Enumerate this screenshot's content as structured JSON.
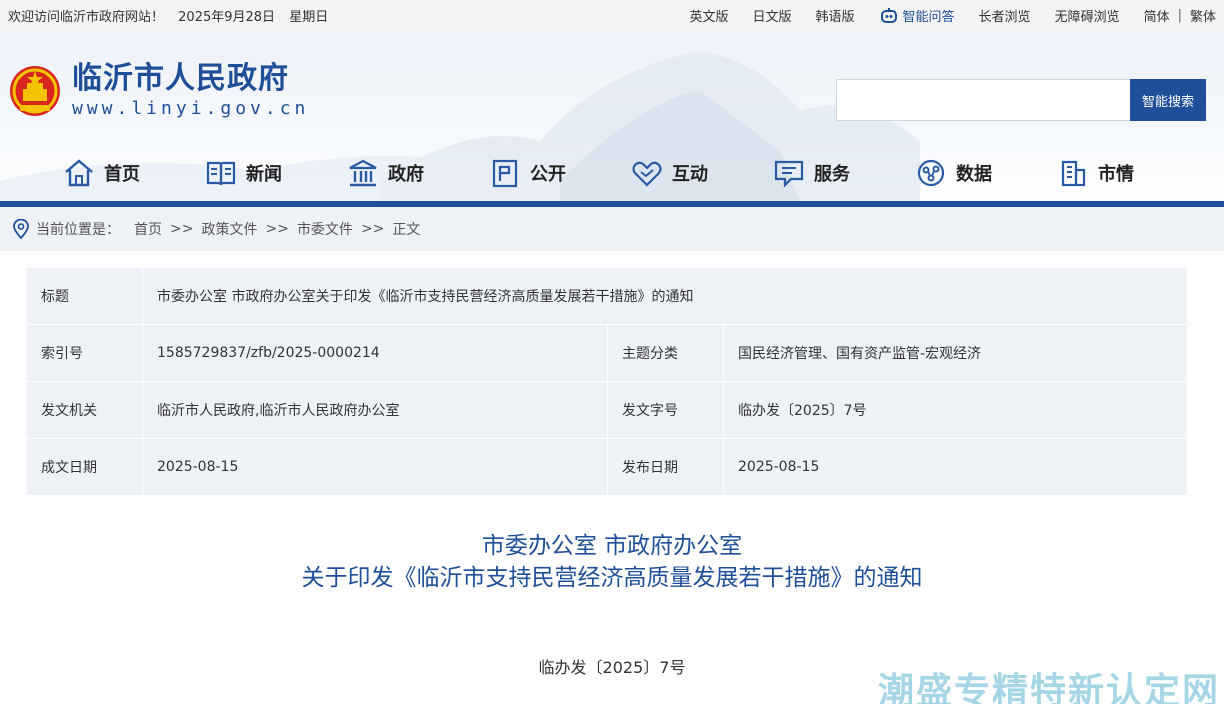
{
  "topbar": {
    "welcome": "欢迎访问临沂市政府网站！",
    "date": "2025年9月28日",
    "weekday": "星期日",
    "links": [
      "英文版",
      "日文版",
      "韩语版"
    ],
    "qa_label": "智能问答",
    "elder": "长者浏览",
    "accessible": "无障碍浏览",
    "simplified": "简体",
    "separator": "|",
    "traditional": "繁体"
  },
  "brand": {
    "title": "临沂市人民政府",
    "url": "www.linyi.gov.cn"
  },
  "search": {
    "placeholder": "",
    "button": "智能搜索"
  },
  "nav": [
    {
      "label": "首页",
      "icon": "home-icon"
    },
    {
      "label": "新闻",
      "icon": "news-icon"
    },
    {
      "label": "政府",
      "icon": "government-icon"
    },
    {
      "label": "公开",
      "icon": "disclosure-icon"
    },
    {
      "label": "互动",
      "icon": "interaction-icon"
    },
    {
      "label": "服务",
      "icon": "service-icon"
    },
    {
      "label": "数据",
      "icon": "data-icon"
    },
    {
      "label": "市情",
      "icon": "city-icon"
    }
  ],
  "breadcrumb": {
    "label": "当前位置是：",
    "items": [
      "首页",
      "政策文件",
      "市委文件",
      "正文"
    ],
    "separator": ">>"
  },
  "info": {
    "title_key": "标题",
    "title_value": "市委办公室 市政府办公室关于印发《临沂市支持民营经济高质量发展若干措施》的通知",
    "rows": [
      {
        "k1": "索引号",
        "v1": "1585729837/zfb/2025-0000214",
        "k2": "主题分类",
        "v2": "国民经济管理、国有资产监管-宏观经济"
      },
      {
        "k1": "发文机关",
        "v1": "临沂市人民政府,临沂市人民政府办公室",
        "k2": "发文字号",
        "v2": "临办发〔2025〕7号"
      },
      {
        "k1": "成文日期",
        "v1": "2025-08-15",
        "k2": "发布日期",
        "v2": "2025-08-15"
      }
    ]
  },
  "doc": {
    "title_line1": "市委办公室 市政府办公室",
    "title_line2": "关于印发《临沂市支持民营经济高质量发展若干措施》的通知",
    "number": "临办发〔2025〕7号"
  },
  "watermark": "潮盛专精特新认定网",
  "colors": {
    "brand": "#1f4f98",
    "table_bg": "#eef2f7",
    "breadcrumb_bg": "#eef1f6"
  }
}
